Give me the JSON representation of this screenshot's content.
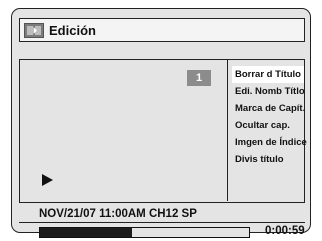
{
  "header": {
    "title": "Edición",
    "icon": "edit-icon"
  },
  "preview": {
    "chapter_number": "1",
    "play_icon": "play-icon"
  },
  "menu": {
    "items": [
      {
        "label": "Borrar d Título",
        "selected": true
      },
      {
        "label": "Edi. Nomb Títlo",
        "selected": false
      },
      {
        "label": "Marca de Capít.",
        "selected": false
      },
      {
        "label": "Ocultar cap.",
        "selected": false
      },
      {
        "label": "Imgen de Índice",
        "selected": false
      },
      {
        "label": "Divis título",
        "selected": false
      }
    ]
  },
  "info": {
    "recording": "NOV/21/07 11:00AM CH12 SP"
  },
  "playback": {
    "progress": 0.44,
    "time": "0:00:59"
  },
  "colors": {
    "background": "#e4e4e4",
    "selected": "#ffffff",
    "chapter_box": "#8c8c8c",
    "progress_fill": "#1c1c1c"
  }
}
